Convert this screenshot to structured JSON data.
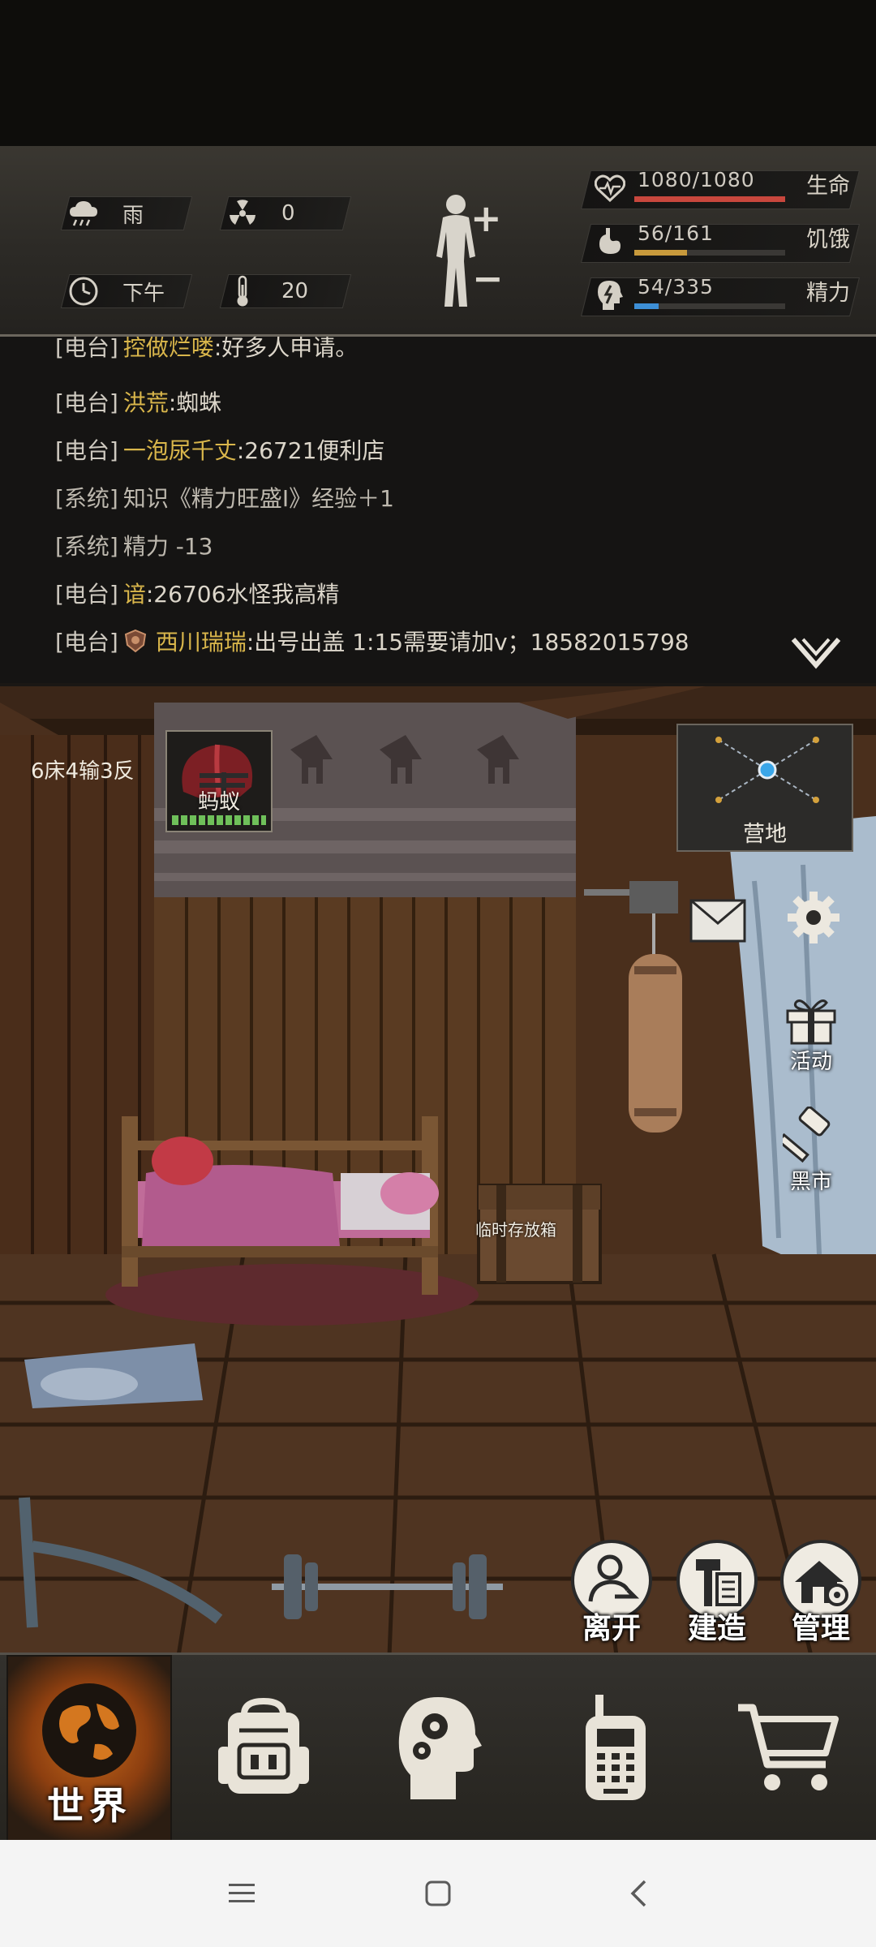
{
  "status": {
    "weather": {
      "icon": "rain-cloud-icon",
      "label": "雨"
    },
    "radiation": {
      "icon": "radiation-icon",
      "value": "0"
    },
    "time": {
      "icon": "clock-icon",
      "label": "下午"
    },
    "temperature": {
      "icon": "thermometer-icon",
      "value": "20"
    },
    "body_button": {
      "icon": "human-body-icon",
      "plus": "+",
      "minus": "−"
    },
    "stats": [
      {
        "key": "health",
        "icon": "heart-pulse-icon",
        "value": "1080/1080",
        "label": "生命",
        "fill": 1.0,
        "color": "#c8473d"
      },
      {
        "key": "hunger",
        "icon": "stomach-icon",
        "value": "56/161",
        "label": "饥饿",
        "fill": 0.348,
        "color": "#c89a3c"
      },
      {
        "key": "energy",
        "icon": "head-energy-icon",
        "value": "54/335",
        "label": "精力",
        "fill": 0.161,
        "color": "#3d8fd6"
      }
    ]
  },
  "chat": {
    "lines": [
      {
        "tag": "[电台]",
        "name": "控做烂喽",
        "msg": ":好多人申请。"
      },
      {
        "tag": "[电台]",
        "name": "洪荒",
        "msg": ":蜘蛛"
      },
      {
        "tag": "[电台]",
        "name": "一泡尿千丈",
        "msg": ":26721便利店"
      },
      {
        "tag": "[系统]",
        "name": "",
        "msg": "知识《精力旺盛Ⅰ》经验＋1"
      },
      {
        "tag": "[系统]",
        "name": "",
        "msg": "精力 -13"
      },
      {
        "tag": "[电台]",
        "name": "谙",
        "msg": ":26706水怪我高精"
      },
      {
        "tag": "[电台]",
        "name": "西川瑞瑞",
        "msg": ":出号出盖 1:15需要请加v；18582015798"
      }
    ],
    "toggle_icon": "chevron-down-icon"
  },
  "scene": {
    "bed_info": "6床4输3反",
    "player_name": "蚂蚁",
    "player_avatar_icon": "football-helmet-icon",
    "map_label": "营地",
    "storage_label": "临时存放箱",
    "side": {
      "mail_icon": "envelope-icon",
      "settings_icon": "gear-icon",
      "activity_label": "活动",
      "activity_icon": "gift-icon",
      "market_label": "黑市",
      "market_icon": "gavel-icon"
    },
    "actions": [
      {
        "label": "离开",
        "icon": "person-exit-icon"
      },
      {
        "label": "建造",
        "icon": "hammer-icon"
      },
      {
        "label": "管理",
        "icon": "house-gear-icon"
      }
    ]
  },
  "nav": {
    "world_label": "世界",
    "world_icon": "globe-icon",
    "items": [
      {
        "name": "backpack",
        "icon": "backpack-icon"
      },
      {
        "name": "skills",
        "icon": "head-gears-icon"
      },
      {
        "name": "radio",
        "icon": "walkie-talkie-icon"
      },
      {
        "name": "shop",
        "icon": "shopping-cart-icon"
      }
    ]
  },
  "system_bar": {
    "menu_icon": "menu-icon",
    "home_icon": "home-square-icon",
    "back_icon": "back-chevron-icon"
  }
}
